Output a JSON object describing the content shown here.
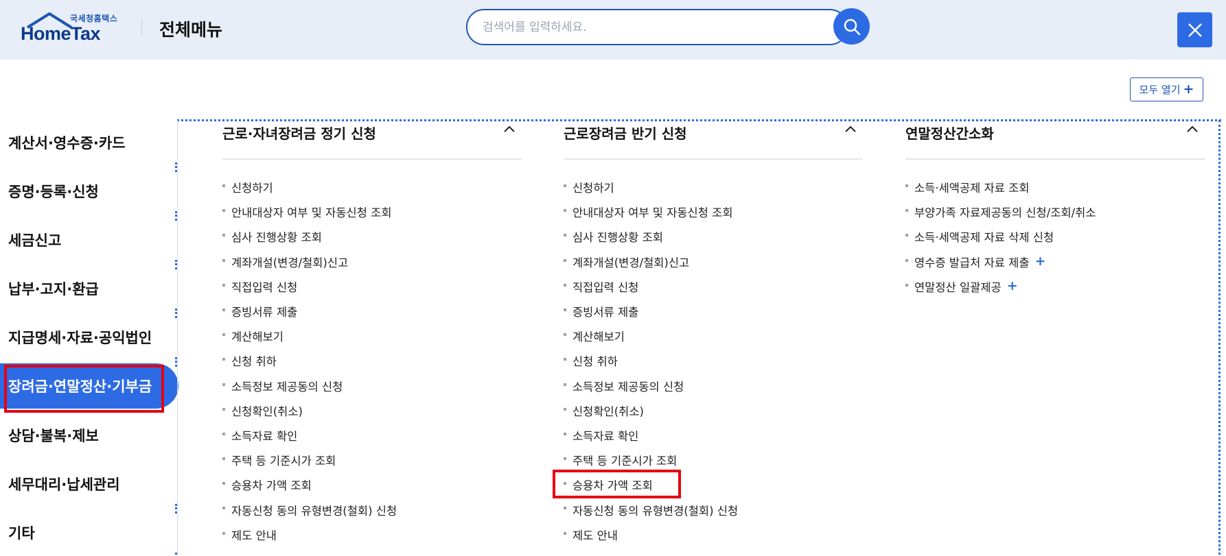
{
  "header": {
    "logo_small": "국세청홈택스",
    "logo_main": "HomeTax",
    "title": "전체메뉴",
    "search_placeholder": "검색어를 입력하세요.",
    "search_value": ""
  },
  "expand_all": {
    "label": "모두 열기",
    "icon": "plus-icon"
  },
  "sidebar": {
    "items": [
      {
        "label": "계산서·영수증·카드"
      },
      {
        "label": "증명·등록·신청"
      },
      {
        "label": "세금신고"
      },
      {
        "label": "납부·고지·환급"
      },
      {
        "label": "지급명세·자료·공익법인"
      },
      {
        "label": "장려금·연말정산·기부금",
        "active": true
      },
      {
        "label": "상담·불복·제보"
      },
      {
        "label": "세무대리·납세관리"
      },
      {
        "label": "기타"
      }
    ]
  },
  "columns": [
    {
      "title": "근로·자녀장려금 정기 신청",
      "items": [
        "신청하기",
        "안내대상자 여부 및 자동신청 조회",
        "심사 진행상황 조회",
        "계좌개설(변경/철회)신고",
        "직접입력 신청",
        "증빙서류 제출",
        "계산해보기",
        "신청 취하",
        "소득정보 제공동의 신청",
        "신청확인(취소)",
        "소득자료 확인",
        "주택 등 기준시가 조회",
        "승용차 가액 조회",
        "자동신청 동의 유형변경(철회) 신청",
        "제도 안내"
      ]
    },
    {
      "title": "근로장려금 반기 신청",
      "items": [
        "신청하기",
        "안내대상자 여부 및 자동신청 조회",
        "심사 진행상황 조회",
        "계좌개설(변경/철회)신고",
        "직접입력 신청",
        "증빙서류 제출",
        "계산해보기",
        "신청 취하",
        "소득정보 제공동의 신청",
        "신청확인(취소)",
        "소득자료 확인",
        "주택 등 기준시가 조회",
        "승용차 가액 조회",
        "자동신청 동의 유형변경(철회) 신청",
        "제도 안내"
      ]
    },
    {
      "title": "연말정산간소화",
      "items": [
        "소득·세액공제 자료 조회",
        "부양가족 자료제공동의 신청/조회/취소",
        "소득·세액공제 자료 삭제 신청",
        "영수증 발급처 자료 제출",
        "연말정산 일괄제공"
      ],
      "expandable": [
        3,
        4
      ]
    }
  ],
  "colors": {
    "accent": "#2d6be4",
    "header_bg": "#e8eef7",
    "highlight": "#e60012",
    "logo_dark": "#0b3a8c"
  }
}
